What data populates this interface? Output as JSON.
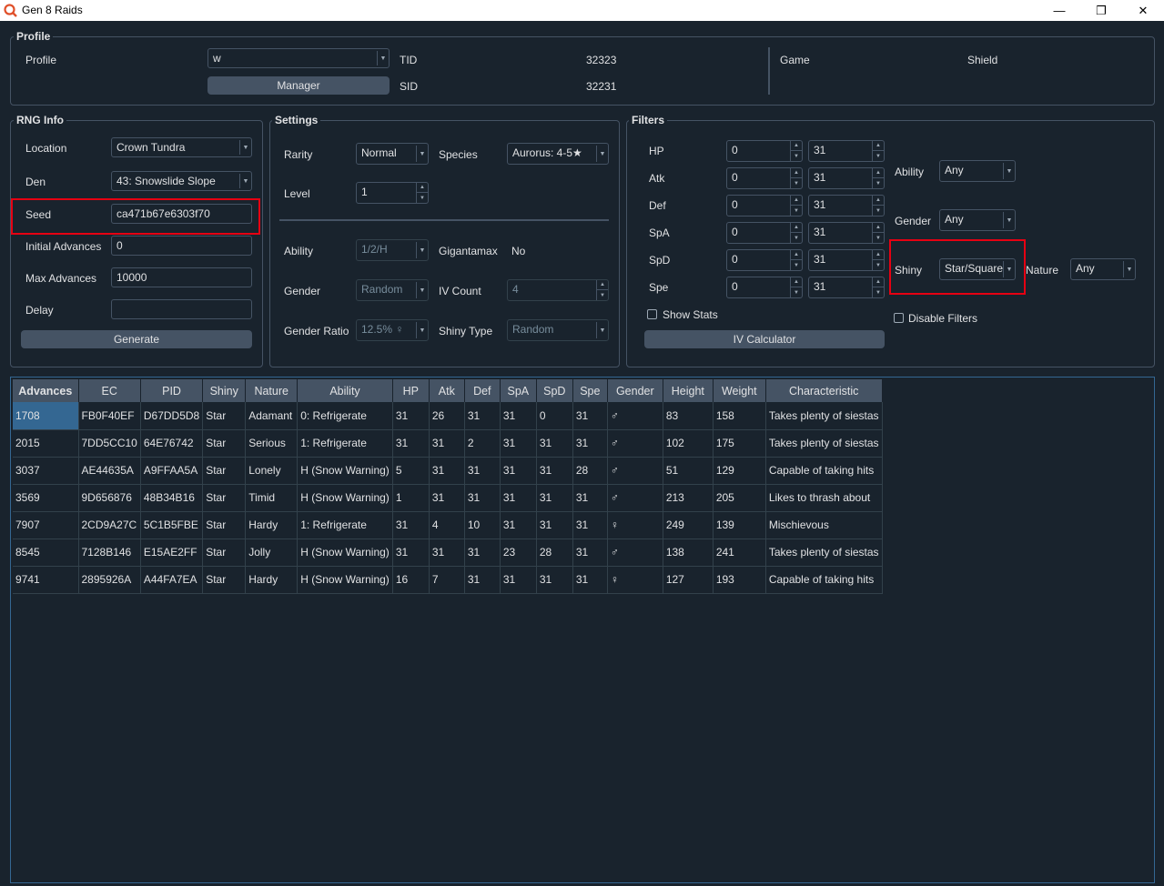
{
  "window": {
    "title": "Gen 8 Raids",
    "minimize": "—",
    "maximize": "❐",
    "close": "✕"
  },
  "profile": {
    "group_title": "Profile",
    "label": "Profile",
    "value": "w",
    "manager_button": "Manager",
    "tid_label": "TID",
    "tid": "32323",
    "sid_label": "SID",
    "sid": "32231",
    "game_label": "Game",
    "game": "Shield"
  },
  "rng": {
    "group_title": "RNG Info",
    "location_label": "Location",
    "location": "Crown Tundra",
    "den_label": "Den",
    "den": "43: Snowslide Slope",
    "seed_label": "Seed",
    "seed": "ca471b67e6303f70",
    "initial_label": "Initial Advances",
    "initial": "0",
    "max_label": "Max Advances",
    "max": "10000",
    "delay_label": "Delay",
    "delay": "",
    "generate_button": "Generate"
  },
  "settings": {
    "group_title": "Settings",
    "rarity_label": "Rarity",
    "rarity": "Normal",
    "species_label": "Species",
    "species": "Aurorus: 4-5★",
    "level_label": "Level",
    "level": "1",
    "ability_label": "Ability",
    "ability": "1/2/H",
    "gigantamax_label": "Gigantamax",
    "gigantamax": "No",
    "gender_label": "Gender",
    "gender": "Random",
    "ivcount_label": "IV Count",
    "ivcount": "4",
    "ratio_label": "Gender Ratio",
    "ratio": "12.5% ♀",
    "shinytype_label": "Shiny Type",
    "shinytype": "Random"
  },
  "filters": {
    "group_title": "Filters",
    "stats": [
      {
        "label": "HP",
        "min": "0",
        "max": "31"
      },
      {
        "label": "Atk",
        "min": "0",
        "max": "31"
      },
      {
        "label": "Def",
        "min": "0",
        "max": "31"
      },
      {
        "label": "SpA",
        "min": "0",
        "max": "31"
      },
      {
        "label": "SpD",
        "min": "0",
        "max": "31"
      },
      {
        "label": "Spe",
        "min": "0",
        "max": "31"
      }
    ],
    "ability_label": "Ability",
    "ability": "Any",
    "gender_label": "Gender",
    "gender": "Any",
    "shiny_label": "Shiny",
    "shiny": "Star/Square",
    "nature_label": "Nature",
    "nature": "Any",
    "show_stats": "Show Stats",
    "disable_filters": "Disable Filters",
    "iv_calc_button": "IV Calculator"
  },
  "table": {
    "headers": [
      "Advances",
      "EC",
      "PID",
      "Shiny",
      "Nature",
      "Ability",
      "HP",
      "Atk",
      "Def",
      "SpA",
      "SpD",
      "Spe",
      "Gender",
      "Height",
      "Weight",
      "Characteristic"
    ],
    "rows": [
      [
        "1708",
        "FB0F40EF",
        "D67DD5D8",
        "Star",
        "Adamant",
        "0: Refrigerate",
        "31",
        "26",
        "31",
        "31",
        "0",
        "31",
        "♂",
        "83",
        "158",
        "Takes plenty of siestas"
      ],
      [
        "2015",
        "7DD5CC10",
        "64E76742",
        "Star",
        "Serious",
        "1: Refrigerate",
        "31",
        "31",
        "2",
        "31",
        "31",
        "31",
        "♂",
        "102",
        "175",
        "Takes plenty of siestas"
      ],
      [
        "3037",
        "AE44635A",
        "A9FFAA5A",
        "Star",
        "Lonely",
        "H (Snow Warning)",
        "5",
        "31",
        "31",
        "31",
        "31",
        "28",
        "♂",
        "51",
        "129",
        "Capable of taking hits"
      ],
      [
        "3569",
        "9D656876",
        "48B34B16",
        "Star",
        "Timid",
        "H (Snow Warning)",
        "1",
        "31",
        "31",
        "31",
        "31",
        "31",
        "♂",
        "213",
        "205",
        "Likes to thrash about"
      ],
      [
        "7907",
        "2CD9A27C",
        "5C1B5FBE",
        "Star",
        "Hardy",
        "1: Refrigerate",
        "31",
        "4",
        "10",
        "31",
        "31",
        "31",
        "♀",
        "249",
        "139",
        "Mischievous"
      ],
      [
        "8545",
        "7128B146",
        "E15AE2FF",
        "Star",
        "Jolly",
        "H (Snow Warning)",
        "31",
        "31",
        "31",
        "23",
        "28",
        "31",
        "♂",
        "138",
        "241",
        "Takes plenty of siestas"
      ],
      [
        "9741",
        "2895926A",
        "A44FA7EA",
        "Star",
        "Hardy",
        "H (Snow Warning)",
        "16",
        "7",
        "31",
        "31",
        "31",
        "31",
        "♀",
        "127",
        "193",
        "Capable of taking hits"
      ]
    ]
  }
}
